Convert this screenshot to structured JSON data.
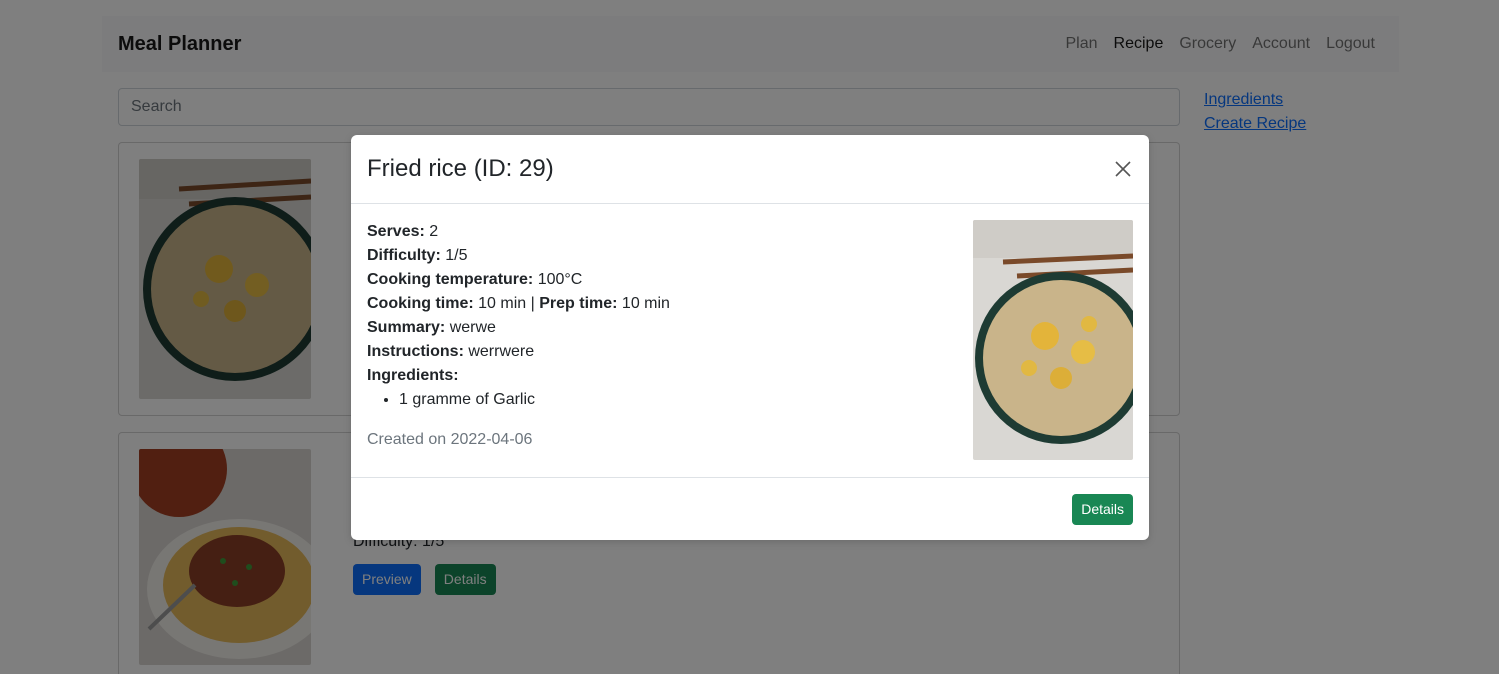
{
  "navbar": {
    "brand": "Meal Planner",
    "links": [
      {
        "label": "Plan",
        "active": false
      },
      {
        "label": "Recipe",
        "active": true
      },
      {
        "label": "Grocery",
        "active": false
      },
      {
        "label": "Account",
        "active": false
      },
      {
        "label": "Logout",
        "active": false
      }
    ]
  },
  "search": {
    "placeholder": "Search"
  },
  "sidebar": {
    "ingredients_link": "Ingredients",
    "create_recipe_link": "Create Recipe"
  },
  "recipe_list": [
    {
      "image": "fried-rice-photo"
    },
    {
      "image": "spaghetti-bolognese-photo",
      "difficulty": "Difficulty: 1/5",
      "preview_label": "Preview",
      "details_label": "Details"
    }
  ],
  "modal": {
    "title": "Fried rice (ID: 29)",
    "serves_label": "Serves:",
    "serves_value": "2",
    "difficulty_label": "Difficulty:",
    "difficulty_value": "1/5",
    "temperature_label": "Cooking temperature:",
    "temperature_value": "100°C",
    "cooking_time_label": "Cooking time:",
    "cooking_time_value": "10 min",
    "separator": "|",
    "prep_time_label": "Prep time:",
    "prep_time_value": "10 min",
    "summary_label": "Summary:",
    "summary_value": "werwe",
    "instructions_label": "Instructions:",
    "instructions_value": "werrwere",
    "ingredients_label": "Ingredients:",
    "ingredients": [
      "1 gramme of Garlic"
    ],
    "created": "Created on 2022-04-06",
    "details_button": "Details",
    "image": "fried-rice-photo"
  },
  "colors": {
    "primary": "#0d6efd",
    "success": "#198754",
    "backdrop": "rgba(0,0,0,0.5)"
  }
}
